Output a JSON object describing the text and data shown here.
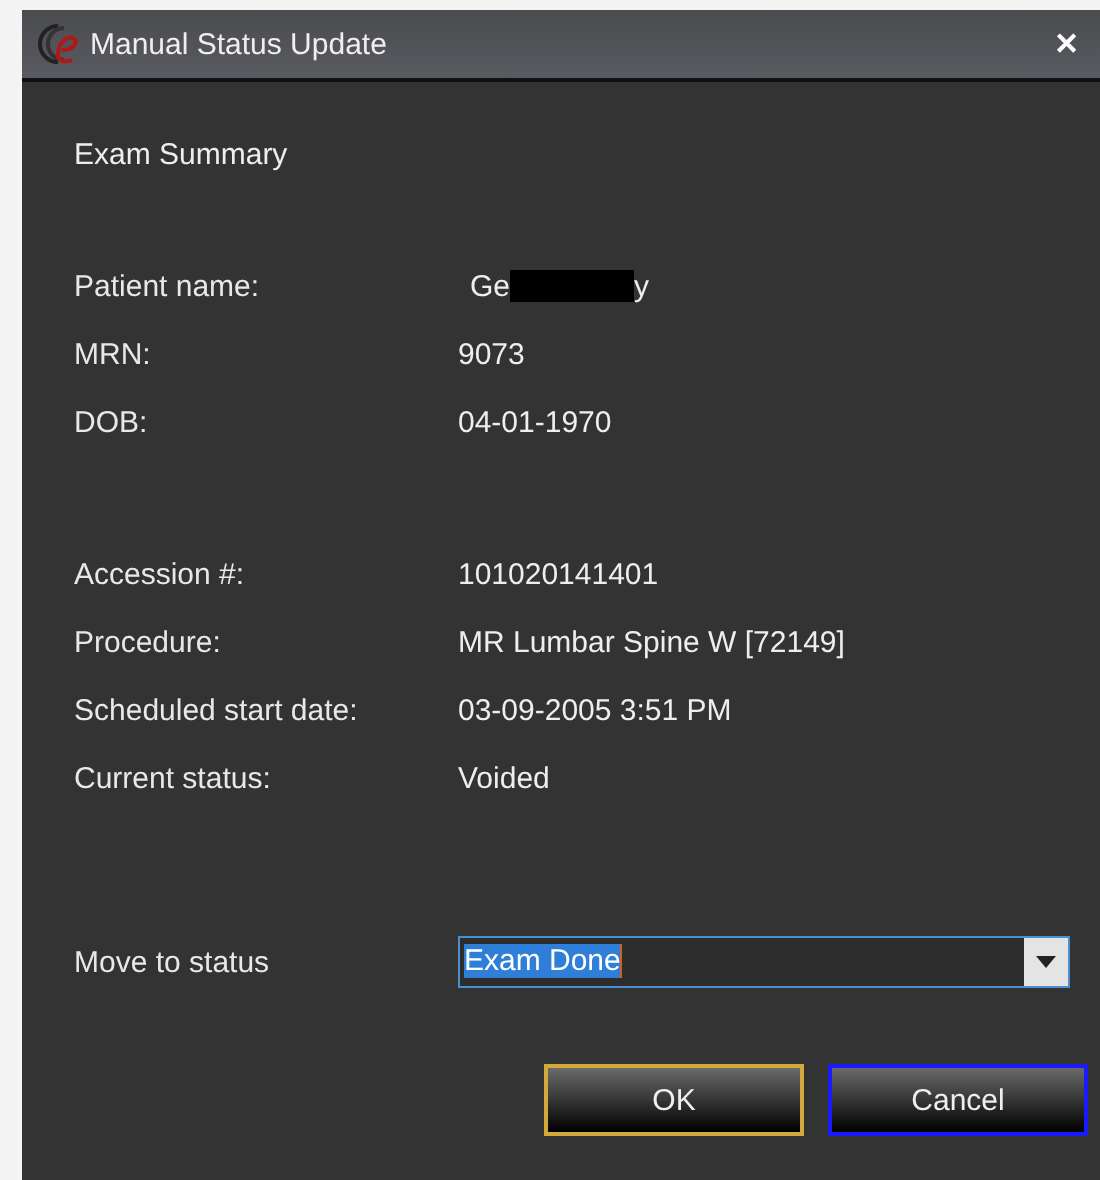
{
  "window": {
    "title": "Manual Status Update",
    "close": "✕"
  },
  "heading": "Exam Summary",
  "groups": [
    {
      "fields": [
        {
          "label": "Patient name:",
          "value": "Ge",
          "value_end": "y",
          "redacted": true
        },
        {
          "label": "MRN:",
          "value": "9073"
        },
        {
          "label": "DOB:",
          "value": "04-01-1970"
        }
      ]
    },
    {
      "fields": [
        {
          "label": "Accession #:",
          "value": "101020141401"
        },
        {
          "label": "Procedure:",
          "value": "MR Lumbar Spine W [72149]"
        },
        {
          "label": "Scheduled start date:",
          "value": "03-09-2005 3:51 PM"
        },
        {
          "label": "Current status:",
          "value": "Voided"
        }
      ]
    }
  ],
  "move_to_status": {
    "label": "Move to status",
    "value": "Exam Done"
  },
  "buttons": [
    {
      "label": "OK",
      "kind": "default"
    },
    {
      "label": "Cancel",
      "kind": "focused"
    }
  ]
}
